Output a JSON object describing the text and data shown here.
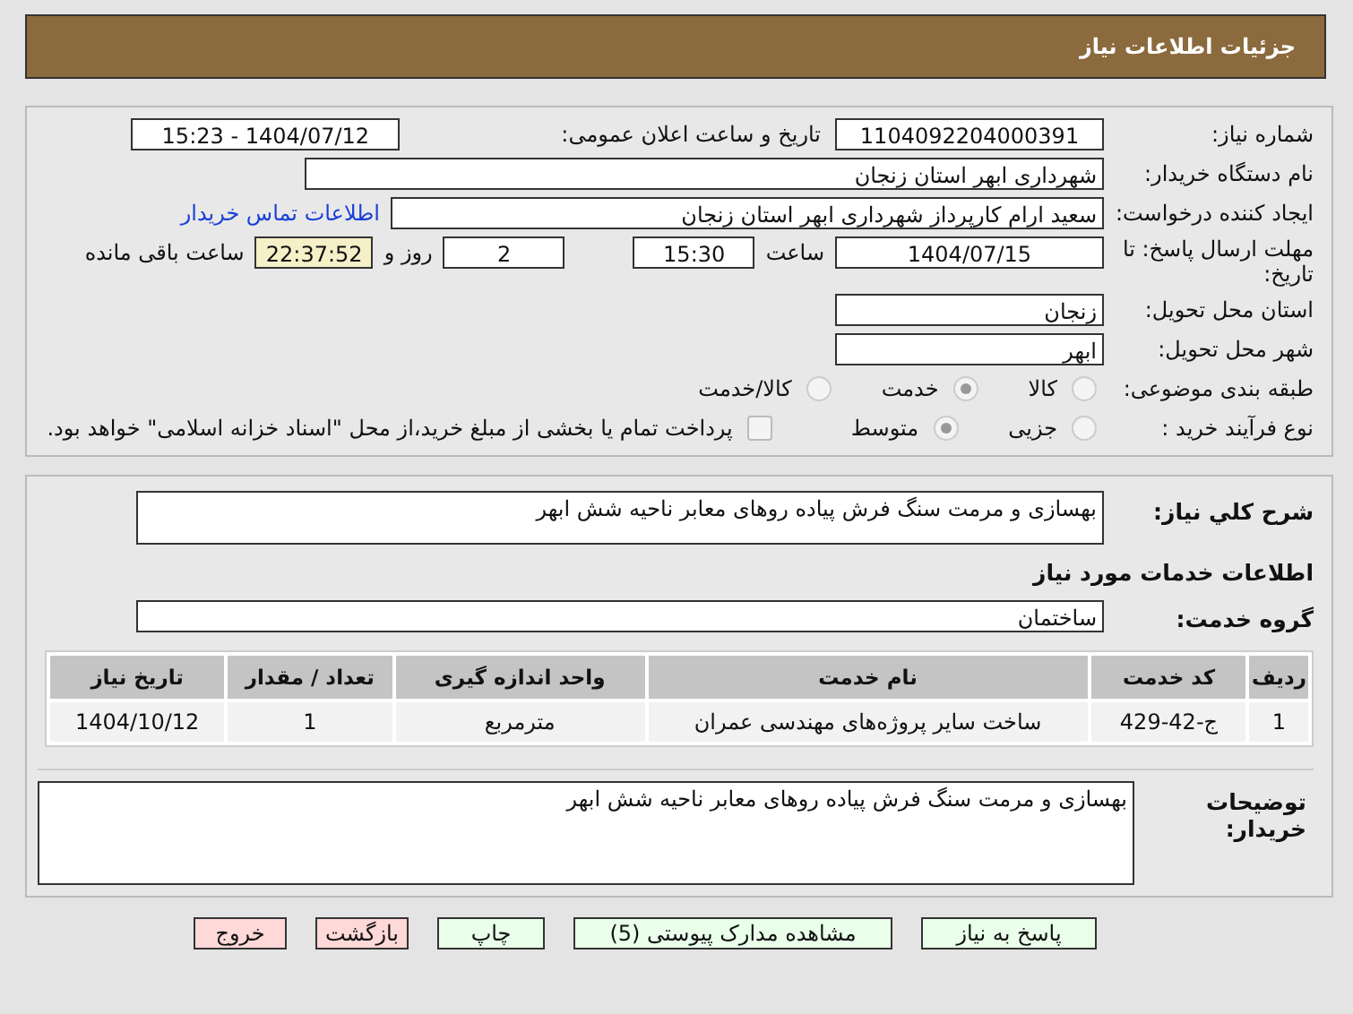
{
  "header": {
    "title": "جزئیات اطلاعات نیاز"
  },
  "need_number": {
    "label": "شماره نیاز:",
    "value": "1104092204000391"
  },
  "announce": {
    "label": "تاریخ و ساعت اعلان عمومی:",
    "value": "1404/07/12 - 15:23"
  },
  "buyer_org": {
    "label": "نام دستگاه خریدار:",
    "value": "شهرداری ابهر استان زنجان"
  },
  "creator": {
    "label": "ایجاد کننده درخواست:",
    "value": "سعید ارام کارپرداز  شهرداری ابهر استان زنجان",
    "link": "اطلاعات تماس خریدار"
  },
  "deadline": {
    "label": "مهلت ارسال پاسخ: تا تاریخ:",
    "date": "1404/07/15",
    "time_label": "ساعت",
    "time": "15:30",
    "days": "2",
    "days_label": "روز و",
    "remaining": "22:37:52",
    "remaining_label": "ساعت باقی مانده"
  },
  "province": {
    "label": "استان محل تحویل:",
    "value": "زنجان"
  },
  "city": {
    "label": "شهر محل تحویل:",
    "value": "ابهر"
  },
  "category": {
    "label": "طبقه بندی موضوعی:",
    "options": [
      {
        "label": "کالا",
        "selected": false
      },
      {
        "label": "خدمت",
        "selected": true
      },
      {
        "label": "کالا/خدمت",
        "selected": false
      }
    ]
  },
  "process": {
    "label": "نوع فرآیند خرید :",
    "options": [
      {
        "label": "جزیی",
        "selected": false
      },
      {
        "label": "متوسط",
        "selected": true
      }
    ],
    "payment": {
      "checked": false,
      "text": "پرداخت تمام یا بخشی از مبلغ خرید،از محل \"اسناد خزانه اسلامی\" خواهد بود."
    }
  },
  "description": {
    "label": "شرح کلي نیاز:",
    "value": "بهسازی و مرمت سنگ فرش پیاده روهای معابر ناحیه شش ابهر"
  },
  "services_title": "اطلاعات خدمات مورد نیاز",
  "service_group": {
    "label": "گروه خدمت:",
    "value": "ساختمان"
  },
  "table": {
    "columns": [
      "ردیف",
      "کد خدمت",
      "نام خدمت",
      "واحد اندازه گیری",
      "تعداد / مقدار",
      "تاریخ نیاز"
    ],
    "rows": [
      [
        "1",
        "ج-42-429",
        "ساخت سایر پروژه‌های مهندسی عمران",
        "مترمربع",
        "1",
        "1404/10/12"
      ]
    ]
  },
  "buyer_notes": {
    "label": "توضیحات خریدار:",
    "value": "بهسازی و مرمت سنگ فرش پیاده روهای معابر ناحیه شش ابهر"
  },
  "buttons": [
    {
      "label": "پاسخ به نیاز",
      "kind": "normal"
    },
    {
      "label": "مشاهده مدارک پیوستی (5)",
      "kind": "normal"
    },
    {
      "label": "چاپ",
      "kind": "normal"
    },
    {
      "label": "بازگشت",
      "kind": "danger"
    },
    {
      "label": "خروج",
      "kind": "danger"
    }
  ]
}
